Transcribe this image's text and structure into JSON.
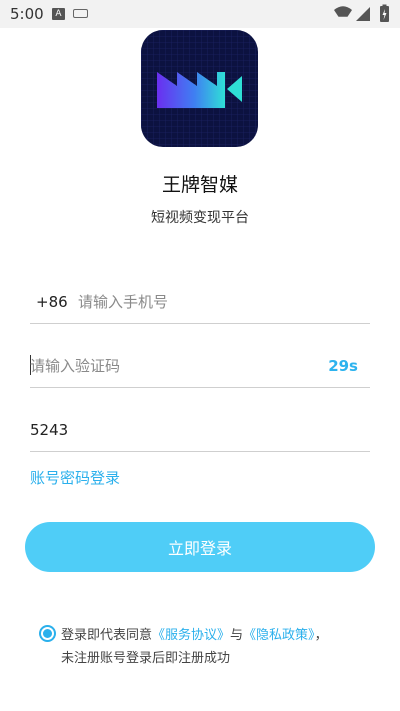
{
  "status_bar": {
    "time": "5:00",
    "notification_icon": "a-icon",
    "keyboard_icon": "keyboard-icon",
    "wifi_icon": "wifi-icon",
    "signal_icon": "signal-icon",
    "battery_icon": "battery-charging-icon"
  },
  "app": {
    "name": "王牌智媒",
    "subtitle": "短视频变现平台",
    "logo_icon": "video-camera-logo-icon",
    "logo_colors": {
      "background": "#0c1240",
      "accent_purple": "#7b3cf0",
      "accent_teal": "#2fe0d6"
    }
  },
  "form": {
    "country_code": "+86",
    "phone_placeholder": "请输入手机号",
    "phone_value": "",
    "code_placeholder": "请输入验证码",
    "code_value": "",
    "countdown": "29s",
    "captcha_value": "5243",
    "account_login_label": "账号密码登录",
    "login_button_label": "立即登录"
  },
  "agreement": {
    "checked": true,
    "prefix": "登录即代表同意",
    "service_link": "《服务协议》",
    "and_text": "与",
    "privacy_link": "《隐私政策》",
    "suffix": "，",
    "line2": "未注册账号登录后即注册成功"
  },
  "colors": {
    "accent": "#2bb0ec",
    "button": "#4fcdf7",
    "divider": "#cfcfcf"
  }
}
